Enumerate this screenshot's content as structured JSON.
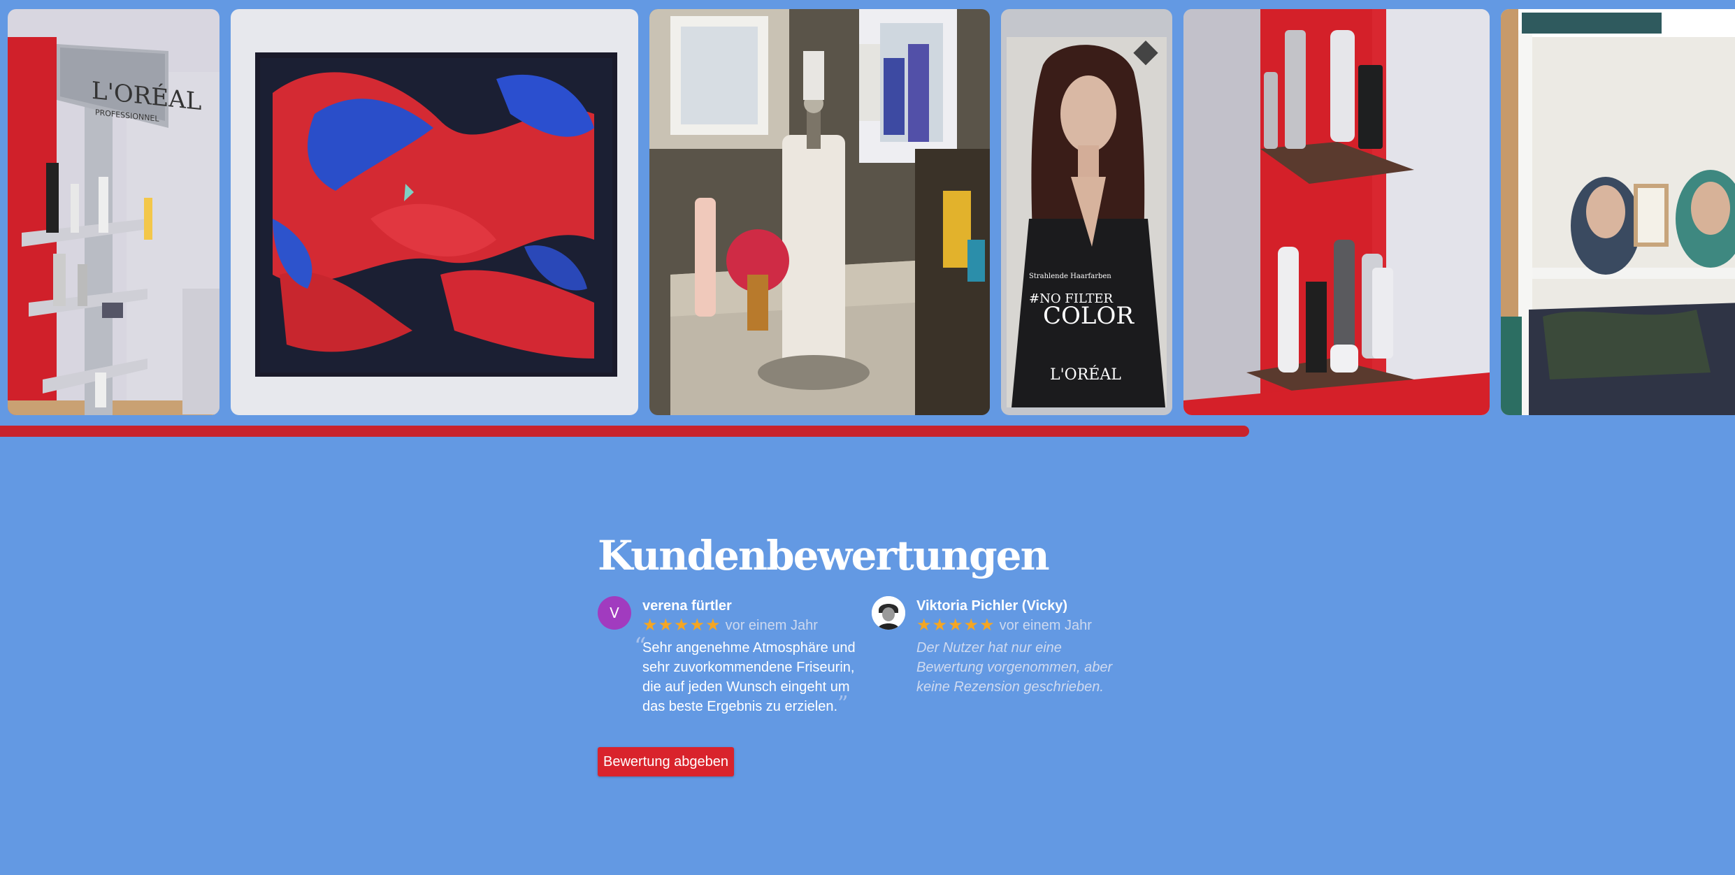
{
  "gallery": {
    "photos": [
      {
        "id": "loreal-display-shelf",
        "alt": ""
      },
      {
        "id": "abstract-painting",
        "alt": ""
      },
      {
        "id": "salon-counter-products",
        "alt": ""
      },
      {
        "id": "loreal-color-poster",
        "alt": ""
      },
      {
        "id": "red-corner-shelf",
        "alt": ""
      },
      {
        "id": "mannequin-headscarves-shelf",
        "alt": ""
      }
    ],
    "progress_fraction": 0.72,
    "progress_color": "#c8232c"
  },
  "reviews": {
    "title": "Kundenbewertungen",
    "items": [
      {
        "avatar_letter": "V",
        "avatar_color": "#a13bbf",
        "name": "verena fürtler",
        "stars": "★★★★★",
        "date": "vor einem Jahr",
        "text": "Sehr angenehme Atmosphäre und sehr zuvorkommendene Friseurin, die auf jeden Wunsch eingeht um das beste Ergebnis zu erzielen."
      },
      {
        "avatar_icon": "user-photo-icon",
        "name": "Viktoria Pichler (Vicky)",
        "stars": "★★★★★",
        "date": "vor einem Jahr",
        "text": "Der Nutzer hat nur eine Bewertung vorgenommen, aber keine Rezension geschrieben."
      }
    ],
    "button_label": "Bewertung abgeben",
    "button_color": "#d9232c"
  },
  "colors": {
    "background": "#6399e3",
    "star": "#f5a623"
  }
}
